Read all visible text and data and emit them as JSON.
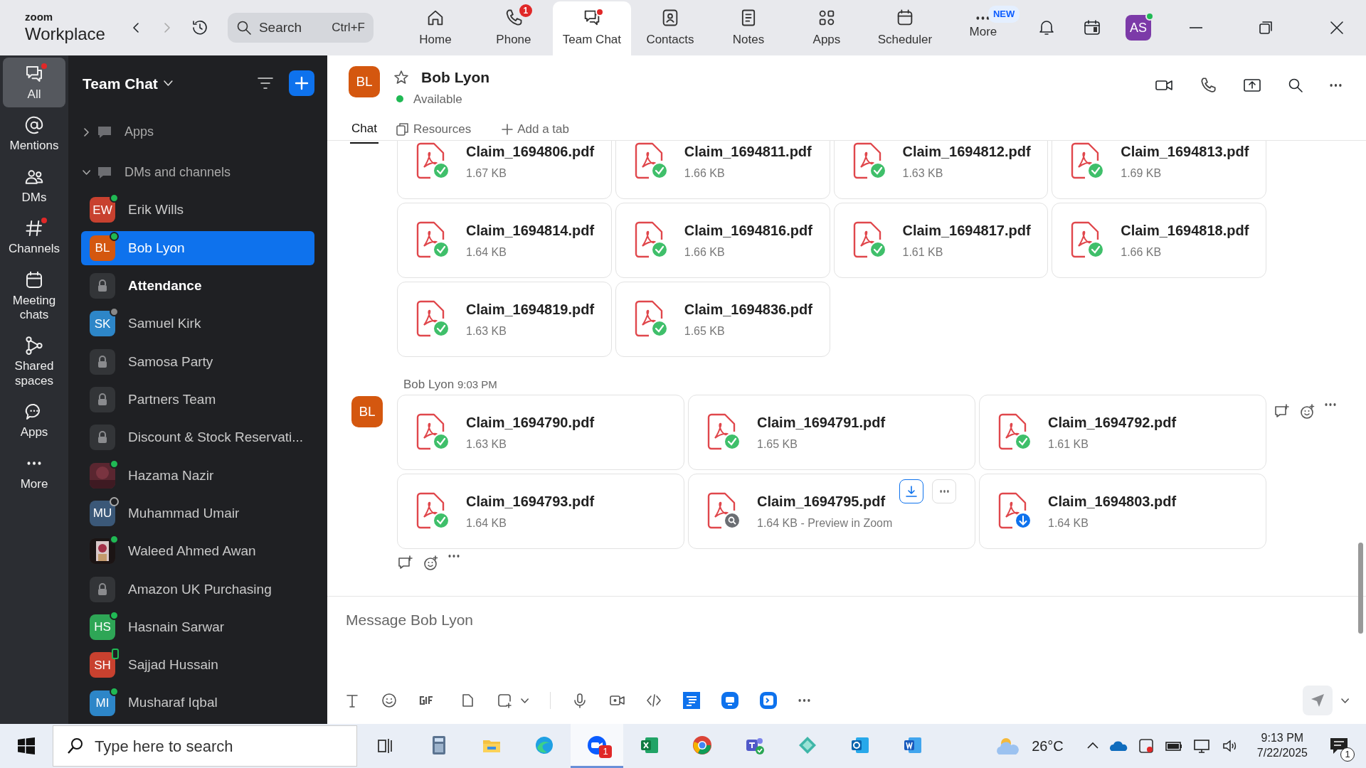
{
  "topbar": {
    "logo_top": "zoom",
    "logo_bottom": "Workplace",
    "search": {
      "placeholder": "Search",
      "shortcut": "Ctrl+F"
    },
    "avatar": "AS",
    "tabs": [
      {
        "label": "Home",
        "selected": false
      },
      {
        "label": "Phone",
        "selected": false,
        "badge": "1"
      },
      {
        "label": "Team Chat",
        "selected": true,
        "dot": true
      },
      {
        "label": "Contacts",
        "selected": false
      },
      {
        "label": "Notes",
        "selected": false
      },
      {
        "label": "Apps",
        "selected": false
      },
      {
        "label": "Scheduler",
        "selected": false
      },
      {
        "label": "More",
        "selected": false,
        "tag": "NEW"
      }
    ]
  },
  "rail": [
    {
      "label": "All",
      "selected": true,
      "dot": true
    },
    {
      "label": "Mentions",
      "selected": false,
      "dot": false
    },
    {
      "label": "DMs",
      "selected": false,
      "dot": false
    },
    {
      "label": "Channels",
      "selected": false,
      "dot": true
    },
    {
      "label": "Meeting chats",
      "selected": false,
      "dot": false
    },
    {
      "label": "Shared spaces",
      "selected": false,
      "dot": false
    },
    {
      "label": "Apps",
      "selected": false,
      "dot": false
    },
    {
      "label": "More",
      "selected": false,
      "dot": false
    }
  ],
  "sidebar": {
    "title": "Team Chat",
    "sections": [
      {
        "label": "Apps",
        "expanded": false
      },
      {
        "label": "DMs and channels",
        "expanded": true
      }
    ],
    "items": [
      {
        "kind": "person",
        "name": "Erik Wills",
        "avatar": "EW",
        "color": "#c8412f",
        "presence": {
          "kind": "online"
        },
        "selected": false,
        "unread": false
      },
      {
        "kind": "person",
        "name": "Bob Lyon",
        "avatar": "BL",
        "color": "#d4570f",
        "presence": {
          "kind": "online"
        },
        "selected": true,
        "unread": false
      },
      {
        "kind": "channel",
        "name": "Attendance",
        "selected": false,
        "unread": true
      },
      {
        "kind": "person",
        "name": "Samuel Kirk",
        "avatar": "SK",
        "color": "#2d86c8",
        "presence": {
          "kind": "away"
        },
        "selected": false,
        "unread": false
      },
      {
        "kind": "channel",
        "name": "Samosa Party",
        "selected": false,
        "unread": false
      },
      {
        "kind": "channel",
        "name": "Partners Team",
        "selected": false,
        "unread": false
      },
      {
        "kind": "channel",
        "name": "Discount & Stock Reservati...",
        "selected": false,
        "unread": false
      },
      {
        "name": "Hazama Nazir",
        "presence": {
          "kind": "online"
        },
        "selected": false,
        "unread": false
      },
      {
        "kind": "person",
        "name": "Muhammad Umair",
        "avatar": "MU",
        "color": "#3b5878",
        "presence": {
          "kind": "offline"
        },
        "selected": false,
        "unread": false
      },
      {
        "name": "Waleed Ahmed Awan",
        "presence": {
          "kind": "online"
        },
        "selected": false,
        "unread": false
      },
      {
        "kind": "channel",
        "name": "Amazon UK Purchasing",
        "selected": false,
        "unread": false
      },
      {
        "kind": "person",
        "name": "Hasnain Sarwar",
        "avatar": "HS",
        "color": "#2ea656",
        "presence": {
          "kind": "online"
        },
        "selected": false,
        "unread": false
      },
      {
        "kind": "person",
        "name": "Sajjad Hussain",
        "avatar": "SH",
        "color": "#c8412f",
        "presence": {
          "kind": "mobile"
        },
        "selected": false,
        "unread": false
      },
      {
        "kind": "person",
        "name": "Musharaf Iqbal",
        "avatar": "MI",
        "color": "#2d86c8",
        "presence": {
          "kind": "online"
        },
        "selected": false,
        "unread": false
      }
    ]
  },
  "chat": {
    "avatar": "BL",
    "name": "Bob Lyon",
    "starred": false,
    "status": "Available",
    "tabs": [
      {
        "label": "Chat",
        "selected": true
      },
      {
        "label": "Resources",
        "selected": false
      }
    ],
    "add_tab": "Add a tab"
  },
  "messages": [
    {
      "files": [
        {
          "name": "Claim_1694806.pdf",
          "size": "1.67 KB",
          "kind": "done"
        },
        {
          "name": "Claim_1694811.pdf",
          "size": "1.66 KB",
          "kind": "done"
        },
        {
          "name": "Claim_1694812.pdf",
          "size": "1.63 KB",
          "kind": "done"
        },
        {
          "name": "Claim_1694813.pdf",
          "size": "1.69 KB",
          "kind": "done"
        },
        {
          "name": "Claim_1694814.pdf",
          "size": "1.64 KB",
          "kind": "done"
        },
        {
          "name": "Claim_1694816.pdf",
          "size": "1.66 KB",
          "kind": "done"
        },
        {
          "name": "Claim_1694817.pdf",
          "size": "1.61 KB",
          "kind": "done"
        },
        {
          "name": "Claim_1694818.pdf",
          "size": "1.66 KB",
          "kind": "done"
        },
        {
          "name": "Claim_1694819.pdf",
          "size": "1.63 KB",
          "kind": "done"
        },
        {
          "name": "Claim_1694836.pdf",
          "size": "1.65 KB",
          "kind": "done"
        }
      ]
    },
    {
      "sender": "Bob Lyon",
      "time": "9:03 PM",
      "avatar": "BL",
      "hovered": true,
      "files": [
        {
          "name": "Claim_1694790.pdf",
          "size": "1.63 KB",
          "kind": "done"
        },
        {
          "name": "Claim_1694791.pdf",
          "size": "1.65 KB",
          "kind": "done"
        },
        {
          "name": "Claim_1694792.pdf",
          "size": "1.61 KB",
          "kind": "done"
        },
        {
          "name": "Claim_1694793.pdf",
          "size": "1.64 KB",
          "kind": "done"
        },
        {
          "name": "Claim_1694795.pdf",
          "size": "1.64 KB - Preview in Zoom",
          "kind": "preview",
          "hovered": true
        },
        {
          "name": "Claim_1694803.pdf",
          "size": "1.64 KB",
          "kind": "download"
        }
      ]
    }
  ],
  "composer": {
    "placeholder": "Message Bob Lyon"
  },
  "taskbar": {
    "search_placeholder": "Type here to search",
    "zoom_badge": "1",
    "temperature": "26°C",
    "time": "9:13 PM",
    "date": "7/22/2025",
    "notifications": "1"
  }
}
